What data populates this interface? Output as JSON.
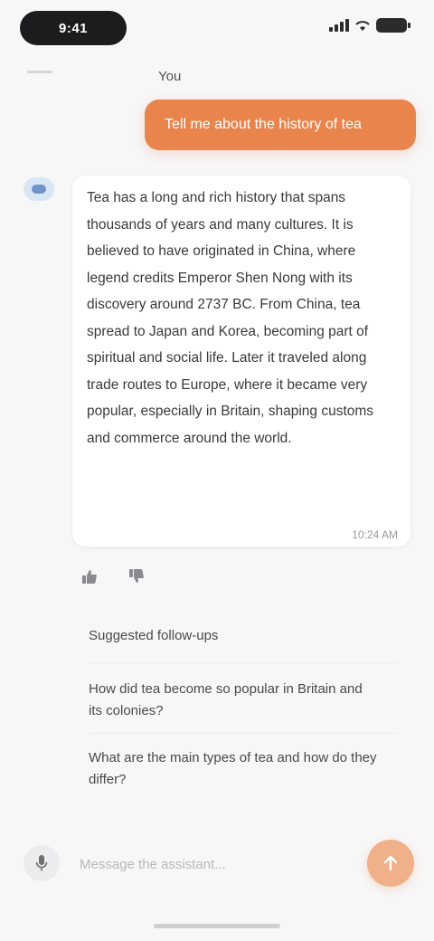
{
  "status_bar": {
    "time": "9:41"
  },
  "user_message": {
    "label": "You",
    "text": "Tell me about the history of tea"
  },
  "assistant_message": {
    "text": "Tea has a long and rich history that spans thousands of years and many cultures. It is believed to have originated in China, where legend credits Emperor Shen Nong with its discovery around 2737 BC. From China, tea spread to Japan and Korea, becoming part of spiritual and social life. Later it traveled along trade routes to Europe, where it became very popular, especially in Britain, shaping customs and commerce around the world.",
    "time": "10:24 AM"
  },
  "suggestions": {
    "header": "Suggested follow-ups",
    "items": [
      "How did tea become so popular in Britain and its colonies?",
      "What are the main types of tea and how do they differ?"
    ]
  },
  "input": {
    "placeholder": "Message the assistant..."
  },
  "colors": {
    "accent": "#e9844c",
    "background": "#f7f7f8",
    "bubble": "#ffffff"
  }
}
